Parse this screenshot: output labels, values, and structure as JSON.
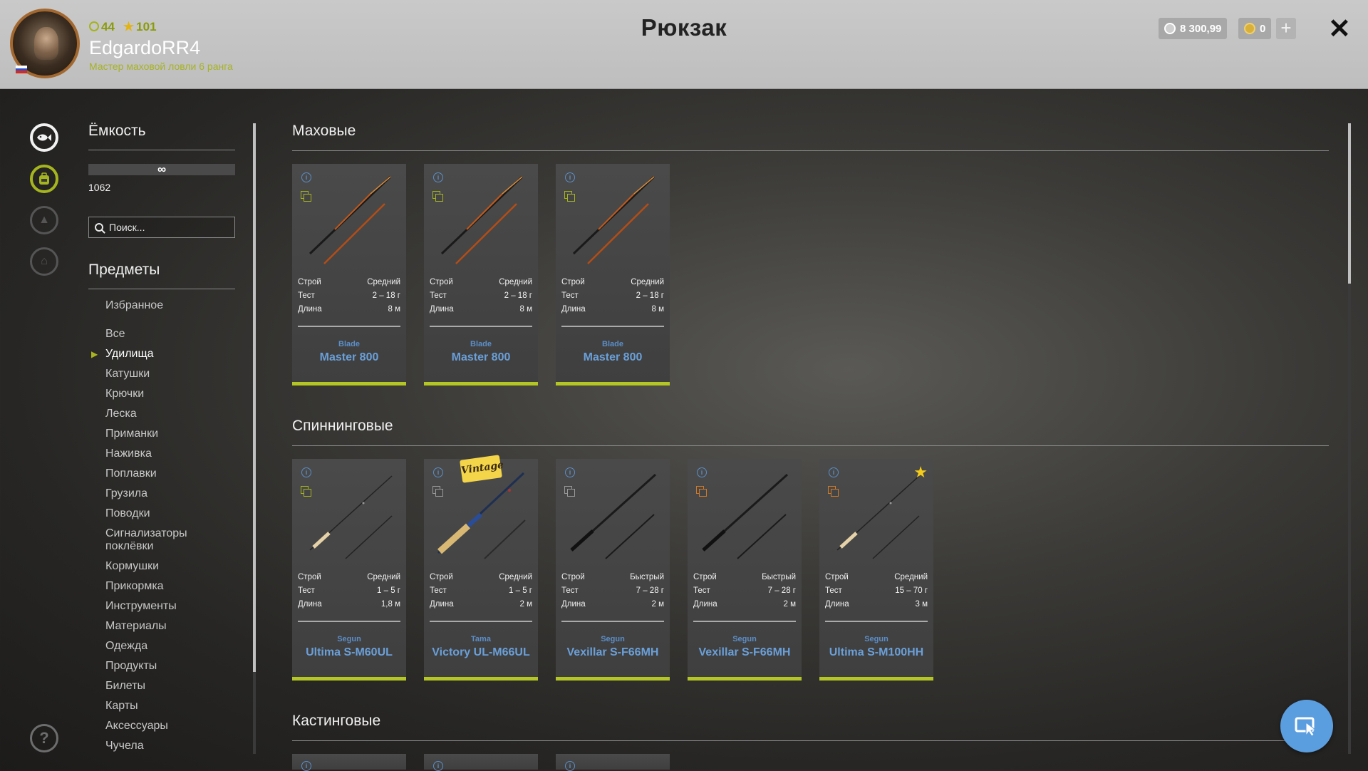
{
  "player": {
    "level": "44",
    "stars": "101",
    "username": "EdgardoRR4",
    "rank": "Мастер маховой ловли 6 ранга",
    "flag": "ru"
  },
  "header": {
    "title": "Рюкзак",
    "silver": "8 300,99",
    "gold": "0",
    "plus": "+",
    "close": "✕"
  },
  "capacity": {
    "title": "Ёмкость",
    "limit": "∞",
    "count": "1062"
  },
  "search": {
    "placeholder": "Поиск..."
  },
  "help": "?",
  "items_title": "Предметы",
  "categories": [
    {
      "label": "Избранное"
    },
    {
      "label": "Все"
    },
    {
      "label": "Удилища",
      "selected": true
    },
    {
      "label": "Катушки"
    },
    {
      "label": "Крючки"
    },
    {
      "label": "Леска"
    },
    {
      "label": "Приманки"
    },
    {
      "label": "Наживка"
    },
    {
      "label": "Поплавки"
    },
    {
      "label": "Грузила"
    },
    {
      "label": "Поводки"
    },
    {
      "label": "Сигнализаторы поклёвки"
    },
    {
      "label": "Кормушки"
    },
    {
      "label": "Прикормка"
    },
    {
      "label": "Инструменты"
    },
    {
      "label": "Материалы"
    },
    {
      "label": "Одежда"
    },
    {
      "label": "Продукты"
    },
    {
      "label": "Билеты"
    },
    {
      "label": "Карты"
    },
    {
      "label": "Аксессуары"
    },
    {
      "label": "Чучела"
    }
  ],
  "spec_labels": {
    "action": "Строй",
    "test": "Тест",
    "length": "Длина"
  },
  "sections": [
    {
      "title": "Маховые",
      "cards": [
        {
          "brand": "Blade",
          "model": "Master 800",
          "action": "Средний",
          "test": "2 – 18 г",
          "length": "8 м",
          "rod_style": "pole",
          "copy_color": "#a5b51e"
        },
        {
          "brand": "Blade",
          "model": "Master 800",
          "action": "Средний",
          "test": "2 – 18 г",
          "length": "8 м",
          "rod_style": "pole",
          "copy_color": "#a5b51e"
        },
        {
          "brand": "Blade",
          "model": "Master 800",
          "action": "Средний",
          "test": "2 – 18 г",
          "length": "8 м",
          "rod_style": "pole",
          "copy_color": "#a5b51e"
        }
      ]
    },
    {
      "title": "Спиннинговые",
      "cards": [
        {
          "brand": "Segun",
          "model": "Ultima S-M60UL",
          "action": "Средний",
          "test": "1 – 5 г",
          "length": "1,8 м",
          "rod_style": "cork",
          "copy_color": "#a5b51e"
        },
        {
          "brand": "Tama",
          "model": "Victory UL-M66UL",
          "action": "Средний",
          "test": "1 – 5 г",
          "length": "2 м",
          "rod_style": "vintage",
          "copy_color": "#9a9a9a",
          "badge": "Vintage"
        },
        {
          "brand": "Segun",
          "model": "Vexillar S-F66MH",
          "action": "Быстрый",
          "test": "7 – 28 г",
          "length": "2 м",
          "rod_style": "dark",
          "copy_color": "#9a9a9a"
        },
        {
          "brand": "Segun",
          "model": "Vexillar S-F66MH",
          "action": "Быстрый",
          "test": "7 – 28 г",
          "length": "2 м",
          "rod_style": "dark",
          "copy_color": "#d07a2a"
        },
        {
          "brand": "Segun",
          "model": "Ultima S-M100HH",
          "action": "Средний",
          "test": "15 – 70 г",
          "length": "3 м",
          "rod_style": "cork",
          "copy_color": "#d07a2a",
          "favorite": true
        }
      ]
    },
    {
      "title": "Кастинговые",
      "cards": []
    }
  ],
  "colors": {
    "accent_green": "#b3c623",
    "link_blue": "#6a9fd8",
    "header_bg": "#c4c4c4"
  }
}
